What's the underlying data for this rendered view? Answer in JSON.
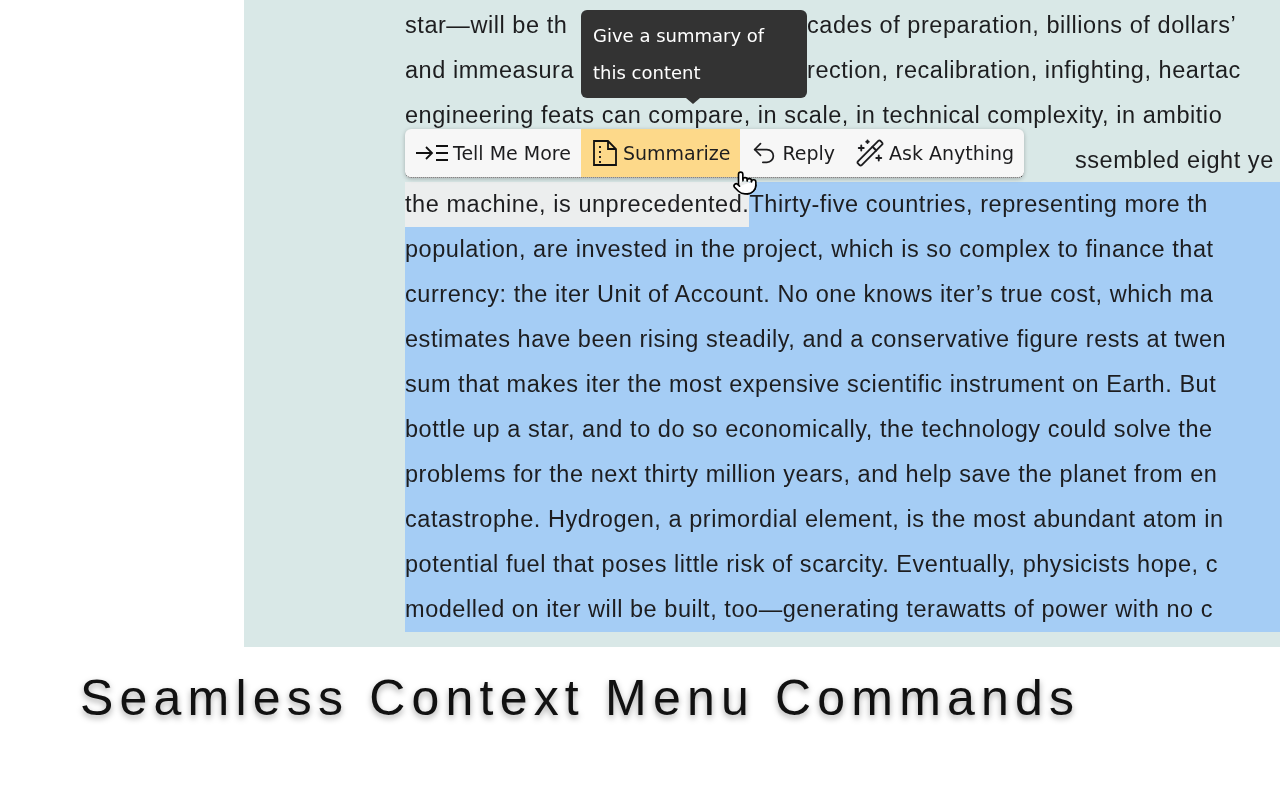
{
  "article": {
    "lines": [
      {
        "kind": "split",
        "segments": [
          {
            "text": "star—will be th",
            "selected": false
          },
          {
            "text": "cades of preparation, billions of dollars’",
            "selected": false
          }
        ]
      },
      {
        "kind": "split",
        "segments": [
          {
            "text": "and immeasura",
            "selected": false
          },
          {
            "text": "rection, recalibration, infighting, heartac",
            "selected": false
          }
        ]
      },
      {
        "kind": "plain",
        "segments": [
          {
            "text": "engineering feats can compare, in scale, in technical complexity, in ambitio",
            "selected": false
          }
        ]
      },
      {
        "kind": "tail",
        "segments": [
          {
            "text": "ssembled eight ye",
            "selected": false
          }
        ]
      },
      {
        "kind": "plain",
        "segments": [
          {
            "text": "the machine, is unprecedented.",
            "selected": false,
            "highlighted": true
          },
          {
            "text": " Thirty-five countries, representing more th",
            "selected": true
          }
        ]
      },
      {
        "kind": "plain",
        "segments": [
          {
            "text": "population, are invested in the project, which is so complex to finance that",
            "selected": true
          }
        ]
      },
      {
        "kind": "plain",
        "segments": [
          {
            "text": "currency: the iter Unit of Account. No one knows iter’s true cost, which ma",
            "selected": true
          }
        ]
      },
      {
        "kind": "plain",
        "segments": [
          {
            "text": "estimates have been rising steadily, and a conservative figure rests at twen",
            "selected": true
          }
        ]
      },
      {
        "kind": "plain",
        "segments": [
          {
            "text": "sum that makes iter the most expensive scientific instrument on Earth. But",
            "selected": true
          }
        ]
      },
      {
        "kind": "plain",
        "segments": [
          {
            "text": "bottle up a star, and to do so economically, the technology could solve the",
            "selected": true
          }
        ]
      },
      {
        "kind": "plain",
        "segments": [
          {
            "text": "problems for the next thirty million years, and help save the planet from en",
            "selected": true
          }
        ]
      },
      {
        "kind": "plain",
        "segments": [
          {
            "text": "catastrophe. Hydrogen, a primordial element, is the most abundant atom in",
            "selected": true
          }
        ]
      },
      {
        "kind": "plain",
        "segments": [
          {
            "text": "potential fuel that poses little risk of scarcity. Eventually, physicists hope, c",
            "selected": true
          }
        ]
      },
      {
        "kind": "plain",
        "segments": [
          {
            "text": "modelled on iter will be built, too—generating terawatts of power with no c",
            "selected": true
          }
        ]
      }
    ]
  },
  "tooltip": {
    "text": "Give a summary of this content"
  },
  "toolbar": {
    "items": [
      {
        "kind": "indent",
        "label": "Tell Me More",
        "selected": false
      },
      {
        "kind": "document",
        "label": "Summarize",
        "selected": true
      },
      {
        "kind": "reply",
        "label": "Reply",
        "selected": false
      },
      {
        "kind": "wand",
        "label": "Ask Anything",
        "selected": false
      }
    ]
  },
  "caption": "Seamless Context Menu Commands"
}
